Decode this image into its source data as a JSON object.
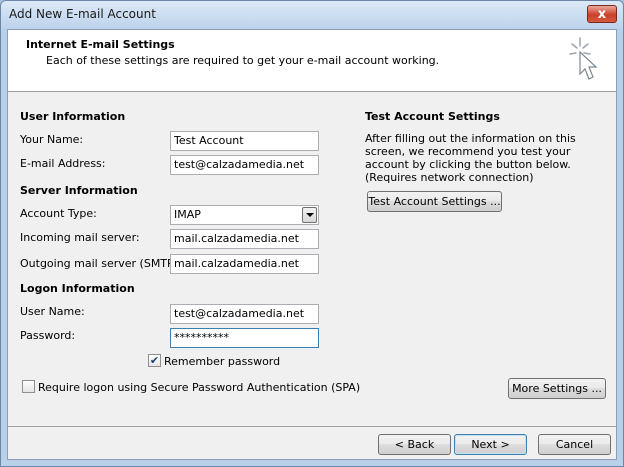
{
  "window": {
    "title": "Add New E-mail Account",
    "close_symbol": "x"
  },
  "header": {
    "title": "Internet E-mail Settings",
    "subtitle": "Each of these settings are required to get your e-mail account working.",
    "icon": "sparkle-cursor-icon"
  },
  "user_info": {
    "section_title": "User Information",
    "name_label": "Your Name:",
    "name_value": "Test Account",
    "email_label": "E-mail Address:",
    "email_value": "test@calzadamedia.net"
  },
  "server_info": {
    "section_title": "Server Information",
    "account_type_label": "Account Type:",
    "account_type_value": "IMAP",
    "incoming_label": "Incoming mail server:",
    "incoming_value": "mail.calzadamedia.net",
    "outgoing_label": "Outgoing mail server (SMTP):",
    "outgoing_value": "mail.calzadamedia.net"
  },
  "logon_info": {
    "section_title": "Logon Information",
    "username_label": "User Name:",
    "username_value": "test@calzadamedia.net",
    "password_label": "Password:",
    "password_value": "**********",
    "remember_label": "Remember password",
    "remember_checked": true,
    "remember_check_glyph": "✔",
    "spa_label": "Require logon using Secure Password Authentication (SPA)",
    "spa_checked": false
  },
  "test_settings": {
    "section_title": "Test Account Settings",
    "description": "After filling out the information on this screen, we recommend you test your account by clicking the button below. (Requires network connection)",
    "test_button": "Test Account Settings ...",
    "more_settings_button": "More Settings ..."
  },
  "footer": {
    "back_button": "< Back",
    "next_button": "Next >",
    "cancel_button": "Cancel"
  }
}
